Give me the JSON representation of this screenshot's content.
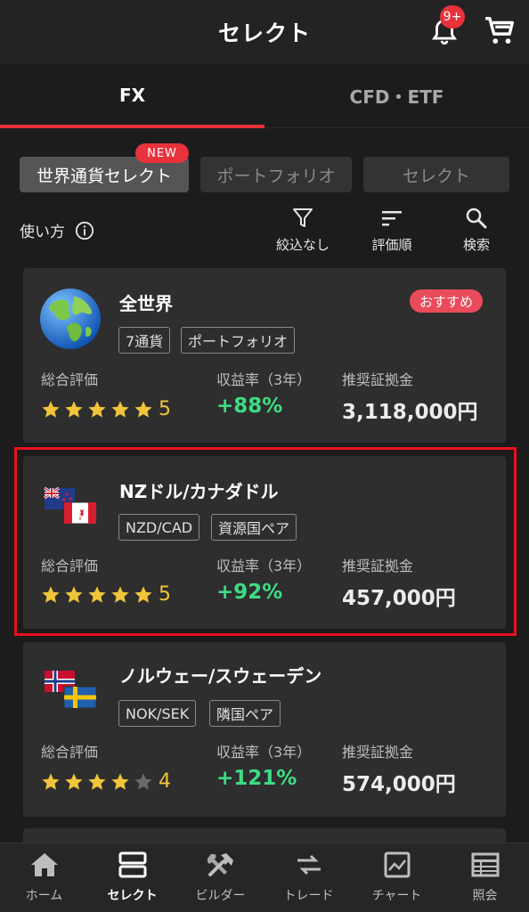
{
  "header": {
    "title": "セレクト",
    "bell_badge": "9+"
  },
  "tabs": [
    {
      "label": "FX"
    },
    {
      "label": "CFD・ETF"
    }
  ],
  "chips": [
    {
      "label": "世界通貨セレクト"
    },
    {
      "label": "ポートフォリオ"
    },
    {
      "label": "セレクト"
    }
  ],
  "new_badge": "NEW",
  "toolbar": {
    "howto": "使い方",
    "filter": "絞込なし",
    "sort": "評価順",
    "search": "検索"
  },
  "cards": [
    {
      "title": "全世界",
      "badge": "おすすめ",
      "tags": [
        "7通貨",
        "ポートフォリオ"
      ],
      "rating_label": "総合評価",
      "rating": 5,
      "score": "5",
      "return_label": "収益率（3年）",
      "return": "+88%",
      "margin_label": "推奨証拠金",
      "margin": "3,118,000円"
    },
    {
      "title": "NZドル/カナダドル",
      "tags": [
        "NZD/CAD",
        "資源国ペア"
      ],
      "rating_label": "総合評価",
      "rating": 5,
      "score": "5",
      "return_label": "収益率（3年）",
      "return": "+92%",
      "margin_label": "推奨証拠金",
      "margin": "457,000円"
    },
    {
      "title": "ノルウェー/スウェーデン",
      "tags": [
        "NOK/SEK",
        "隣国ペア"
      ],
      "rating_label": "総合評価",
      "rating": 4,
      "score": "4",
      "return_label": "収益率（3年）",
      "return": "+121%",
      "margin_label": "推奨証拠金",
      "margin": "574,000円"
    }
  ],
  "bottom_nav": [
    {
      "label": "ホーム",
      "icon": "home-icon"
    },
    {
      "label": "セレクト",
      "icon": "select-icon"
    },
    {
      "label": "ビルダー",
      "icon": "tools-icon"
    },
    {
      "label": "トレード",
      "icon": "trade-icon"
    },
    {
      "label": "チャート",
      "icon": "chart-icon"
    },
    {
      "label": "照会",
      "icon": "table-icon"
    }
  ],
  "colors": {
    "accent": "#e8323c",
    "positive": "#3ddc84",
    "star": "#f1c53a",
    "background": "#1c1c1c"
  }
}
